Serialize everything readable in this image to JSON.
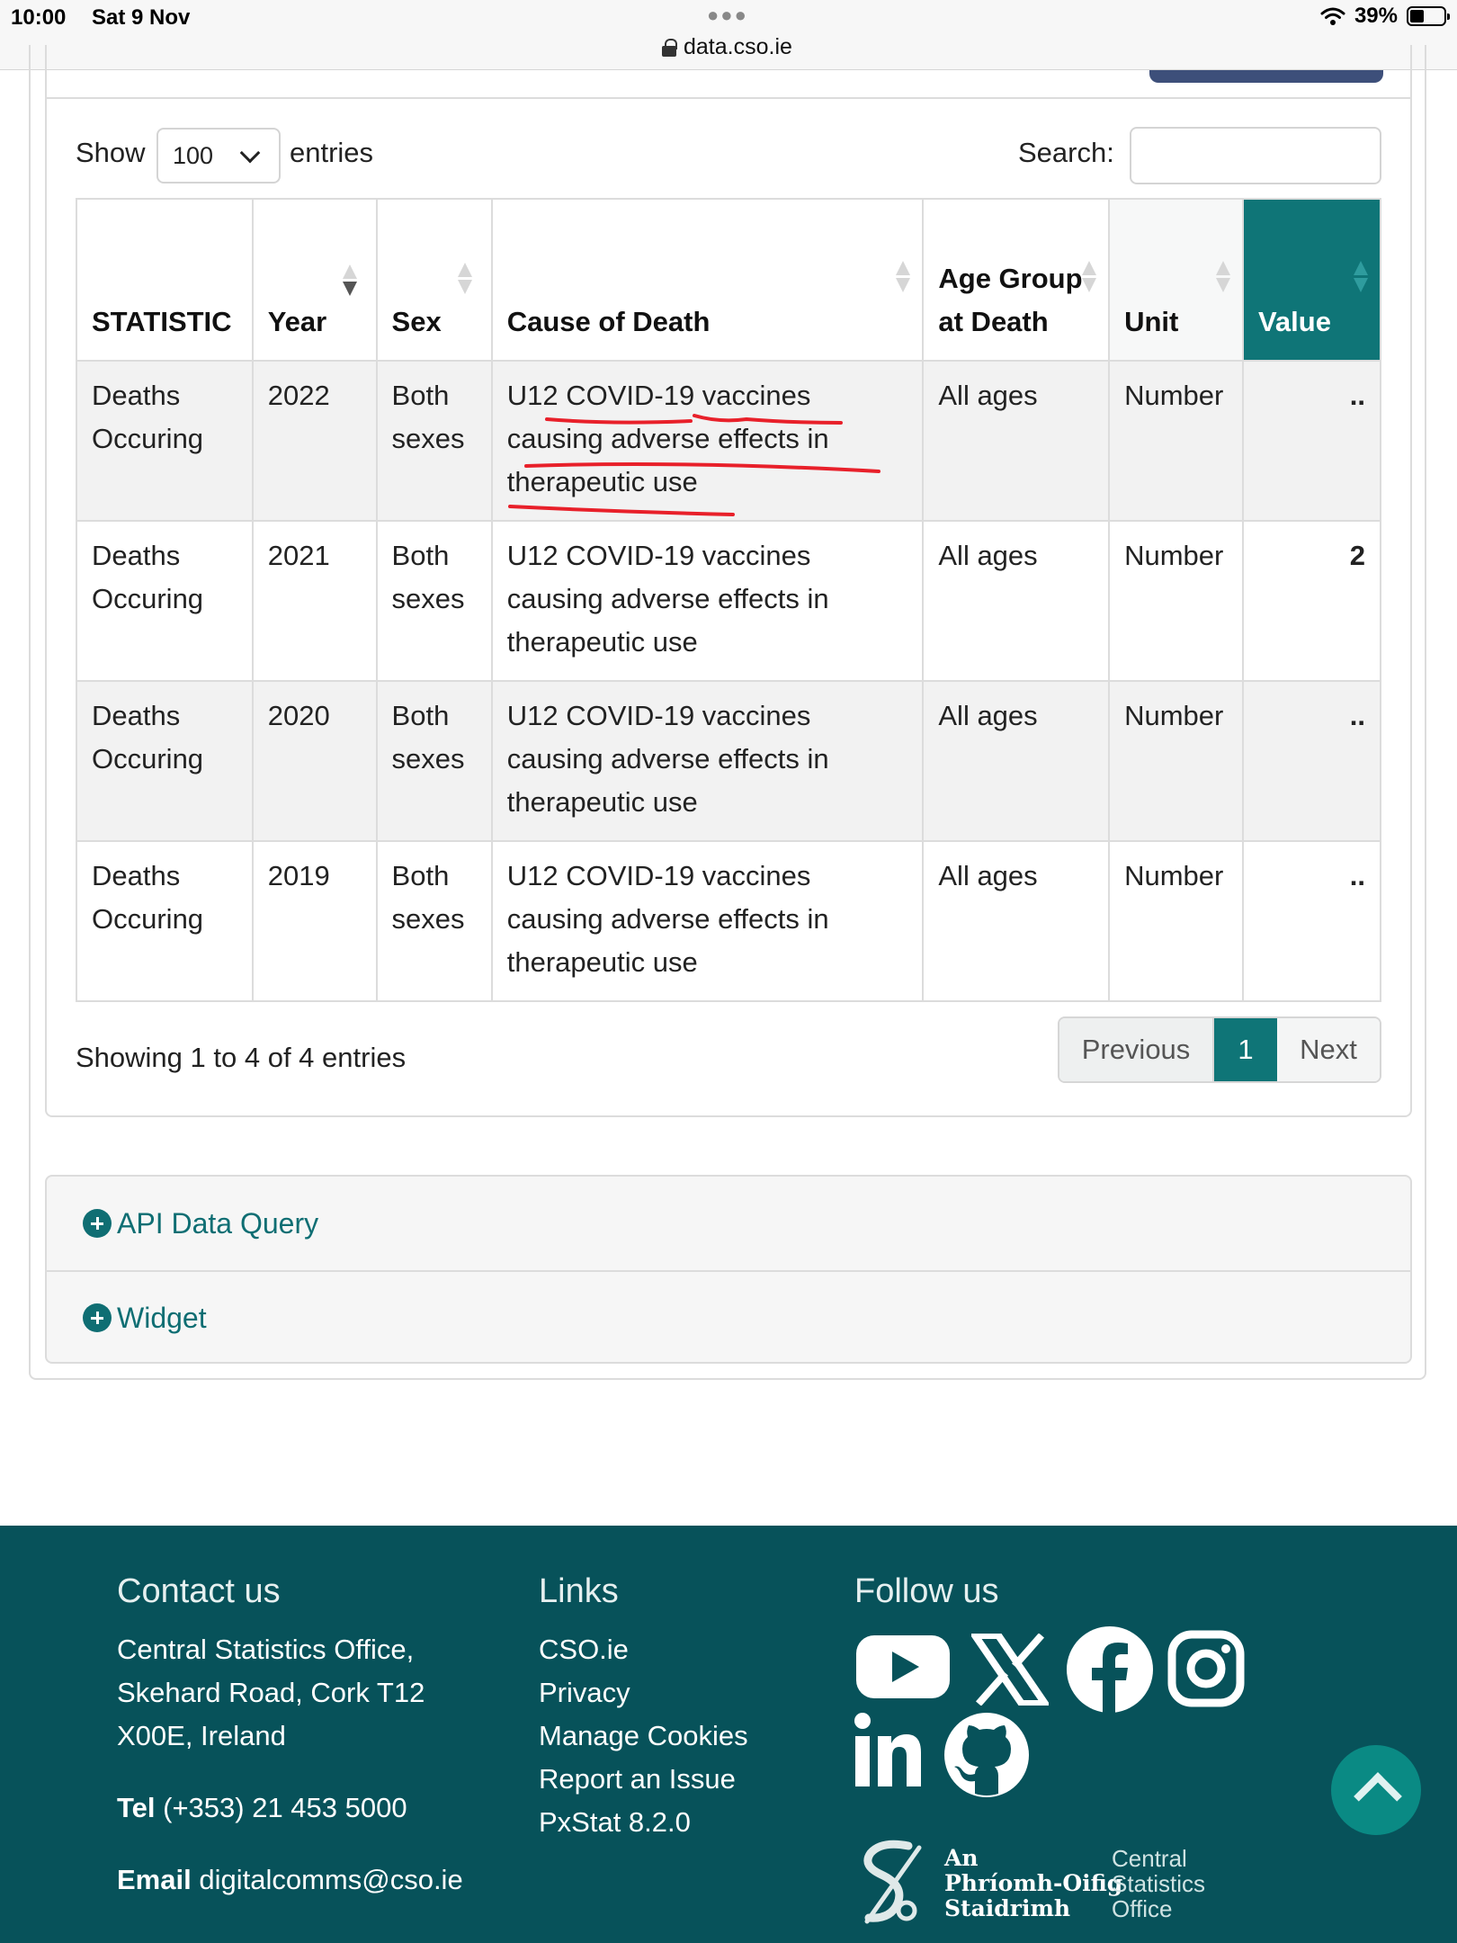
{
  "status_bar": {
    "time": "10:00",
    "date": "Sat 9 Nov",
    "url": "data.cso.ie",
    "battery": "39%"
  },
  "length_control": {
    "prefix": "Show",
    "selected": "100",
    "suffix": "entries"
  },
  "search": {
    "label": "Search:",
    "value": ""
  },
  "table": {
    "columns": [
      "STATISTIC",
      "Year",
      "Sex",
      "Cause of Death",
      "Age Group at Death",
      "Unit",
      "Value"
    ],
    "rows": [
      [
        "Deaths Occuring",
        "2022",
        "Both sexes",
        "U12 COVID-19 vaccines causing adverse effects in therapeutic use",
        "All ages",
        "Number",
        ".."
      ],
      [
        "Deaths Occuring",
        "2021",
        "Both sexes",
        "U12 COVID-19 vaccines causing adverse effects in therapeutic use",
        "All ages",
        "Number",
        "2"
      ],
      [
        "Deaths Occuring",
        "2020",
        "Both sexes",
        "U12 COVID-19 vaccines causing adverse effects in therapeutic use",
        "All ages",
        "Number",
        ".."
      ],
      [
        "Deaths Occuring",
        "2019",
        "Both sexes",
        "U12 COVID-19 vaccines causing adverse effects in therapeutic use",
        "All ages",
        "Number",
        ".."
      ]
    ]
  },
  "info": "Showing 1 to 4 of 4 entries",
  "pagination": {
    "previous": "Previous",
    "current": "1",
    "next": "Next"
  },
  "accordion": {
    "api": "API Data Query",
    "widget": "Widget"
  },
  "footer": {
    "contact_heading": "Contact us",
    "address_lines": [
      "Central Statistics Office,",
      "Skehard Road, Cork T12",
      "X00E, Ireland"
    ],
    "tel_label": "Tel",
    "tel_value": "(+353) 21 453 5000",
    "email_label": "Email",
    "email_value": "digitalcomms@cso.ie",
    "links_heading": "Links",
    "links": [
      "CSO.ie",
      "Privacy",
      "Manage Cookies",
      "Report an Issue",
      "PxStat 8.2.0"
    ],
    "follow_heading": "Follow us",
    "social_icons": [
      "youtube-icon",
      "x-icon",
      "facebook-icon",
      "instagram-icon",
      "linkedin-icon",
      "github-icon"
    ],
    "logo_irish": [
      "An",
      "Phríomh-Oifig",
      "Staidrimh"
    ],
    "logo_english": [
      "Central",
      "Statistics",
      "Office"
    ]
  },
  "colors": {
    "teal": "#0f7577",
    "footer_bg": "#07525a",
    "annotation_red": "#e8202a"
  }
}
